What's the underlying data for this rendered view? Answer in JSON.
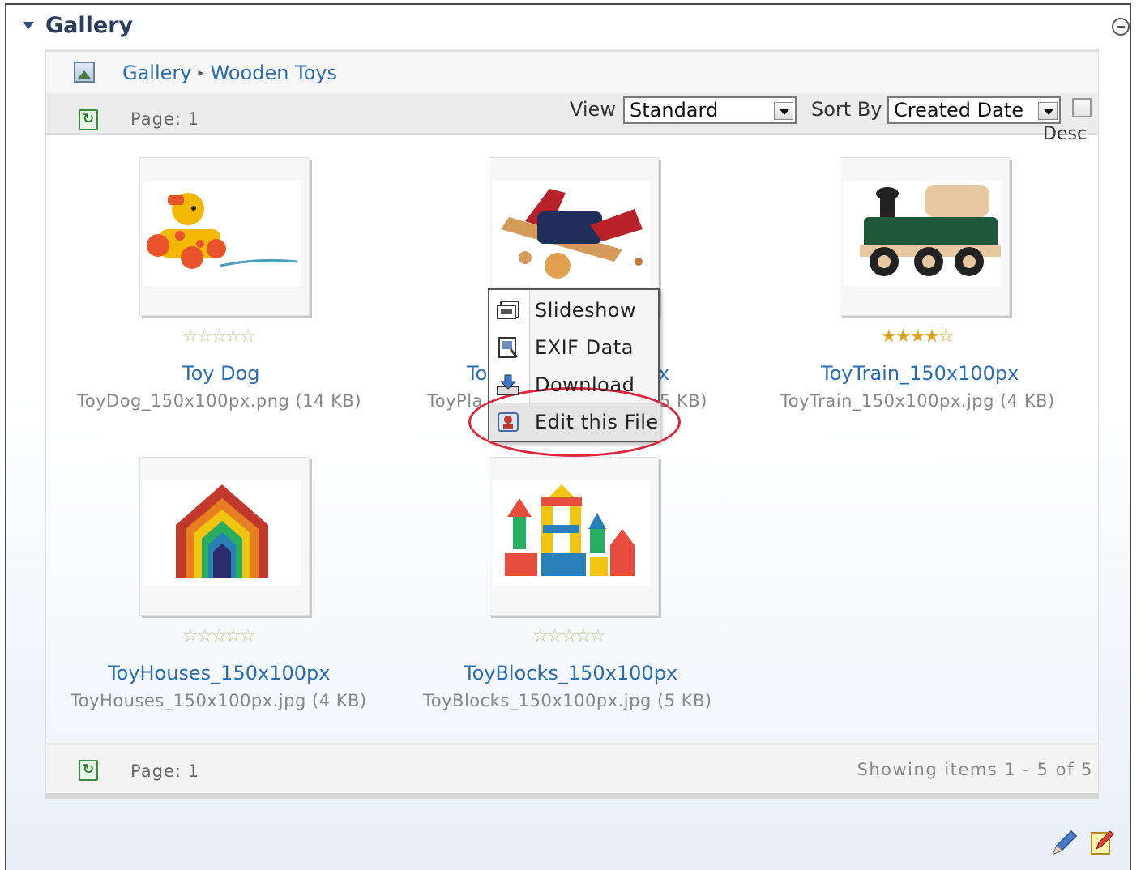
{
  "module": {
    "title": "Gallery"
  },
  "breadcrumb": {
    "items": [
      "Gallery",
      "Wooden Toys"
    ]
  },
  "toolbar": {
    "page_label": "Page: 1",
    "view_label": "View",
    "view_value": "Standard",
    "sort_label": "Sort By",
    "sort_value": "Created Date",
    "desc_label": "Desc"
  },
  "items": [
    {
      "title": "Toy Dog",
      "file": "ToyDog_150x100px.png (14 KB)",
      "rating": 0
    },
    {
      "title": "ToyPlane_150x100px",
      "title_visible": [
        "To",
        "x"
      ],
      "file_visible": [
        "ToyPla",
        "5 KB)"
      ],
      "rating": 0
    },
    {
      "title": "ToyTrain_150x100px",
      "file": "ToyTrain_150x100px.jpg (4 KB)",
      "rating": 4.5
    },
    {
      "title": "ToyHouses_150x100px",
      "file": "ToyHouses_150x100px.jpg (4 KB)",
      "rating": 0
    },
    {
      "title": "ToyBlocks_150x100px",
      "file": "ToyBlocks_150x100px.jpg (5 KB)",
      "rating": 0
    }
  ],
  "stars_glyph": "☆☆☆☆☆",
  "stars_filled_glyph": "★★★★☆",
  "context_menu": {
    "items": [
      {
        "label": "Slideshow",
        "icon": "slideshow-icon"
      },
      {
        "label": "EXIF Data",
        "icon": "exif-icon"
      },
      {
        "label": "Download",
        "icon": "download-icon"
      },
      {
        "label": "Edit this File",
        "icon": "edit-file-icon"
      }
    ],
    "highlighted": "Edit this File",
    "highlight_color": "#e0243a"
  },
  "footer": {
    "page_label": "Page: 1",
    "showing": "Showing items 1 - 5 of 5"
  },
  "colors": {
    "link": "#2b6cb0",
    "title": "#2a3d5c",
    "star_filled": "#e0a020"
  }
}
